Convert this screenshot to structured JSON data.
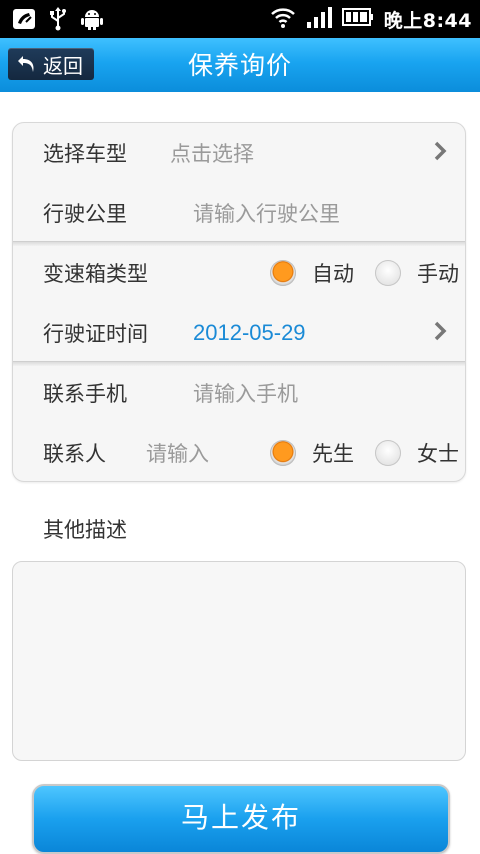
{
  "status_bar": {
    "time": "晚上8:44",
    "icons": [
      "missed-call-icon",
      "usb-icon",
      "android-icon",
      "wifi-icon",
      "signal-icon",
      "battery-icon"
    ]
  },
  "header": {
    "back_label": "返回",
    "title": "保养询价"
  },
  "form": {
    "car_model": {
      "label": "选择车型",
      "placeholder": "点击选择"
    },
    "mileage": {
      "label": "行驶公里",
      "placeholder": "请输入行驶公里"
    },
    "gearbox": {
      "label": "变速箱类型",
      "options": [
        "自动",
        "手动"
      ],
      "selected": "自动"
    },
    "license_date": {
      "label": "行驶证时间",
      "value": "2012-05-29"
    },
    "phone": {
      "label": "联系手机",
      "placeholder": "请输入手机"
    },
    "contact": {
      "label": "联系人",
      "placeholder": "请输入",
      "options": [
        "先生",
        "女士"
      ],
      "selected": "先生"
    }
  },
  "description": {
    "label": "其他描述"
  },
  "submit_label": "马上发布",
  "colors": {
    "accent": "#1aa0ee",
    "date_text": "#1a8ad6",
    "radio_selected": "#ff9a1f"
  }
}
